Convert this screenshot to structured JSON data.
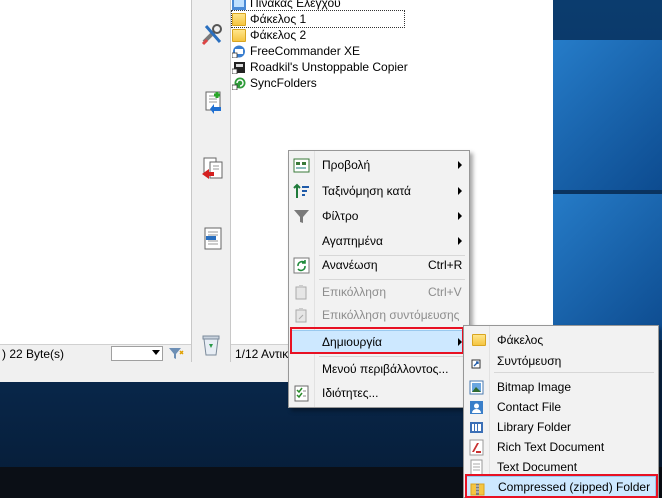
{
  "left_panel": {
    "status_text": ") 22 Byte(s)"
  },
  "right_panel": {
    "files": [
      {
        "name": "Πίνακας Ελέγχου",
        "icon": "control-panel-icon"
      },
      {
        "name": "Φάκελος 1",
        "icon": "folder-icon"
      },
      {
        "name": "Φάκελος 2",
        "icon": "folder-icon"
      },
      {
        "name": "FreeCommander XE",
        "icon": "app-shortcut-icon"
      },
      {
        "name": "Roadkil's Unstoppable Copier",
        "icon": "app-shortcut-icon"
      },
      {
        "name": "SyncFolders",
        "icon": "app-shortcut-icon"
      }
    ],
    "status_text": "1/12 Αντικ"
  },
  "context_menu": {
    "items": [
      {
        "label": "Προβολή",
        "shortcut": "",
        "submenu": true,
        "disabled": false
      },
      {
        "label": "Ταξινόμηση κατά",
        "shortcut": "",
        "submenu": true,
        "disabled": false
      },
      {
        "label": "Φίλτρο",
        "shortcut": "",
        "submenu": true,
        "disabled": false
      },
      {
        "label": "Αγαπημένα",
        "shortcut": "",
        "submenu": true,
        "disabled": false
      },
      {
        "label": "Ανανέωση",
        "shortcut": "Ctrl+R",
        "submenu": false,
        "disabled": false
      },
      {
        "label": "Επικόλληση",
        "shortcut": "Ctrl+V",
        "submenu": false,
        "disabled": true
      },
      {
        "label": "Επικόλληση συντόμευσης",
        "shortcut": "",
        "submenu": false,
        "disabled": true
      },
      {
        "label": "Δημιουργία",
        "shortcut": "",
        "submenu": true,
        "disabled": false,
        "highlighted": true
      },
      {
        "label": "Μενού περιβάλλοντος...",
        "shortcut": "",
        "submenu": false,
        "disabled": false
      },
      {
        "label": "Ιδιότητες...",
        "shortcut": "",
        "submenu": false,
        "disabled": false
      }
    ]
  },
  "new_submenu": {
    "items": [
      {
        "label": "Φάκελος",
        "icon": "folder-icon"
      },
      {
        "label": "Συντόμευση",
        "icon": "shortcut-icon"
      },
      {
        "label": "Bitmap Image",
        "icon": "bitmap-icon"
      },
      {
        "label": "Contact File",
        "icon": "contact-icon"
      },
      {
        "label": "Library Folder",
        "icon": "library-icon"
      },
      {
        "label": "Rich Text Document",
        "icon": "rtf-icon"
      },
      {
        "label": "Text Document",
        "icon": "text-doc-icon"
      },
      {
        "label": "Compressed (zipped) Folder",
        "icon": "zip-folder-icon"
      }
    ]
  },
  "colors": {
    "highlight_frame": "#e81123",
    "menu_hover": "#cde8ff"
  }
}
